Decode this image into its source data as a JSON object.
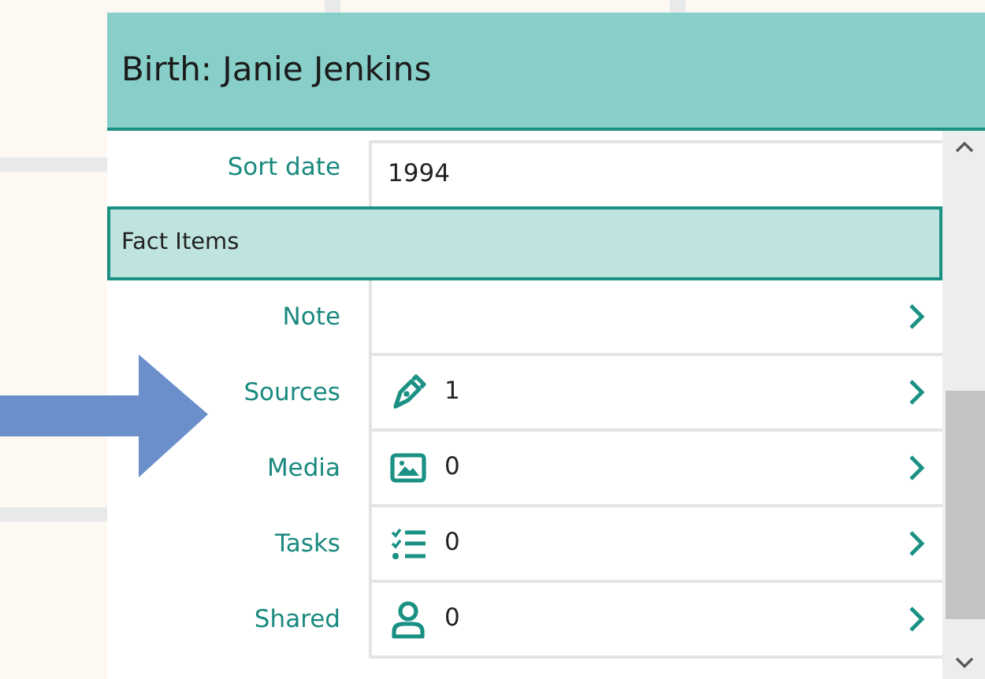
{
  "window": {
    "title": "Birth: Janie Jenkins"
  },
  "fields": [
    {
      "label": "Sort date",
      "value": "1994"
    }
  ],
  "section": {
    "title": "Fact Items"
  },
  "items": [
    {
      "kind": "plain",
      "label": "Note"
    },
    {
      "kind": "count",
      "label": "Sources",
      "count": "1"
    },
    {
      "kind": "count",
      "label": "Media",
      "count": "0"
    },
    {
      "kind": "count",
      "label": "Tasks",
      "count": "0"
    },
    {
      "kind": "count",
      "label": "Shared",
      "count": "0"
    }
  ]
}
